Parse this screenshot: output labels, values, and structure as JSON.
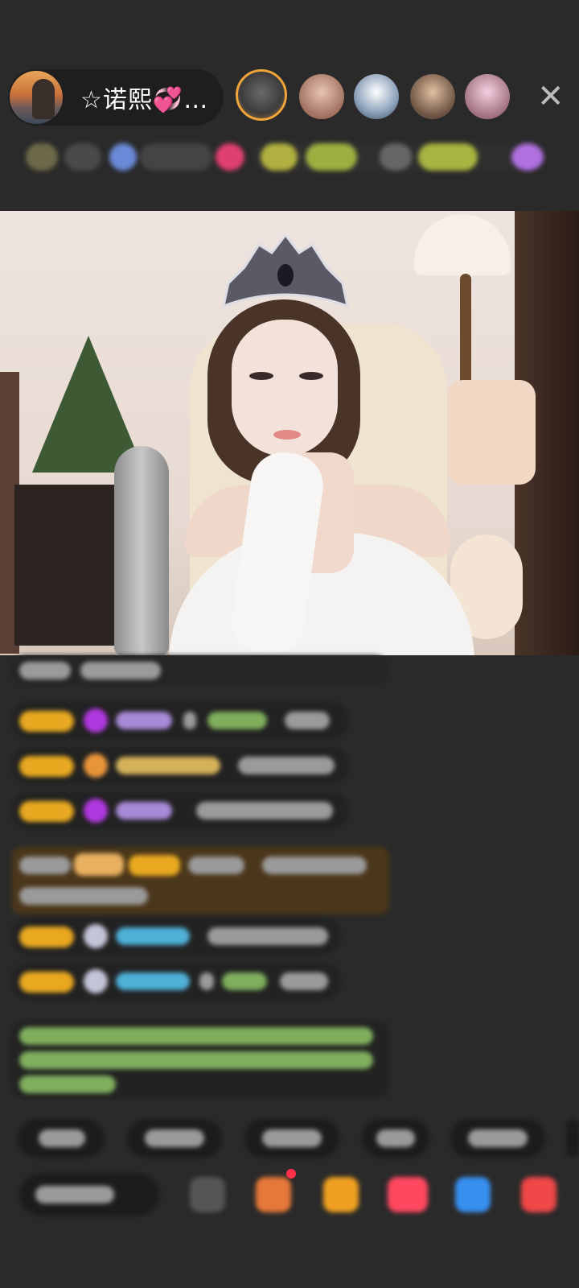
{
  "host": {
    "name": "☆诺熙",
    "heart": "💞",
    "ellipsis": "…"
  },
  "header": {
    "close_icon": "✕"
  },
  "icons": {
    "close": "close-icon",
    "gift": "gift-icon",
    "emoji": "emoji-icon"
  },
  "colors": {
    "background": "#2a2a2a",
    "level_badge": "#e8a820",
    "viewer_ring": "#f0a43a",
    "gift_banner": "#4a361a"
  }
}
